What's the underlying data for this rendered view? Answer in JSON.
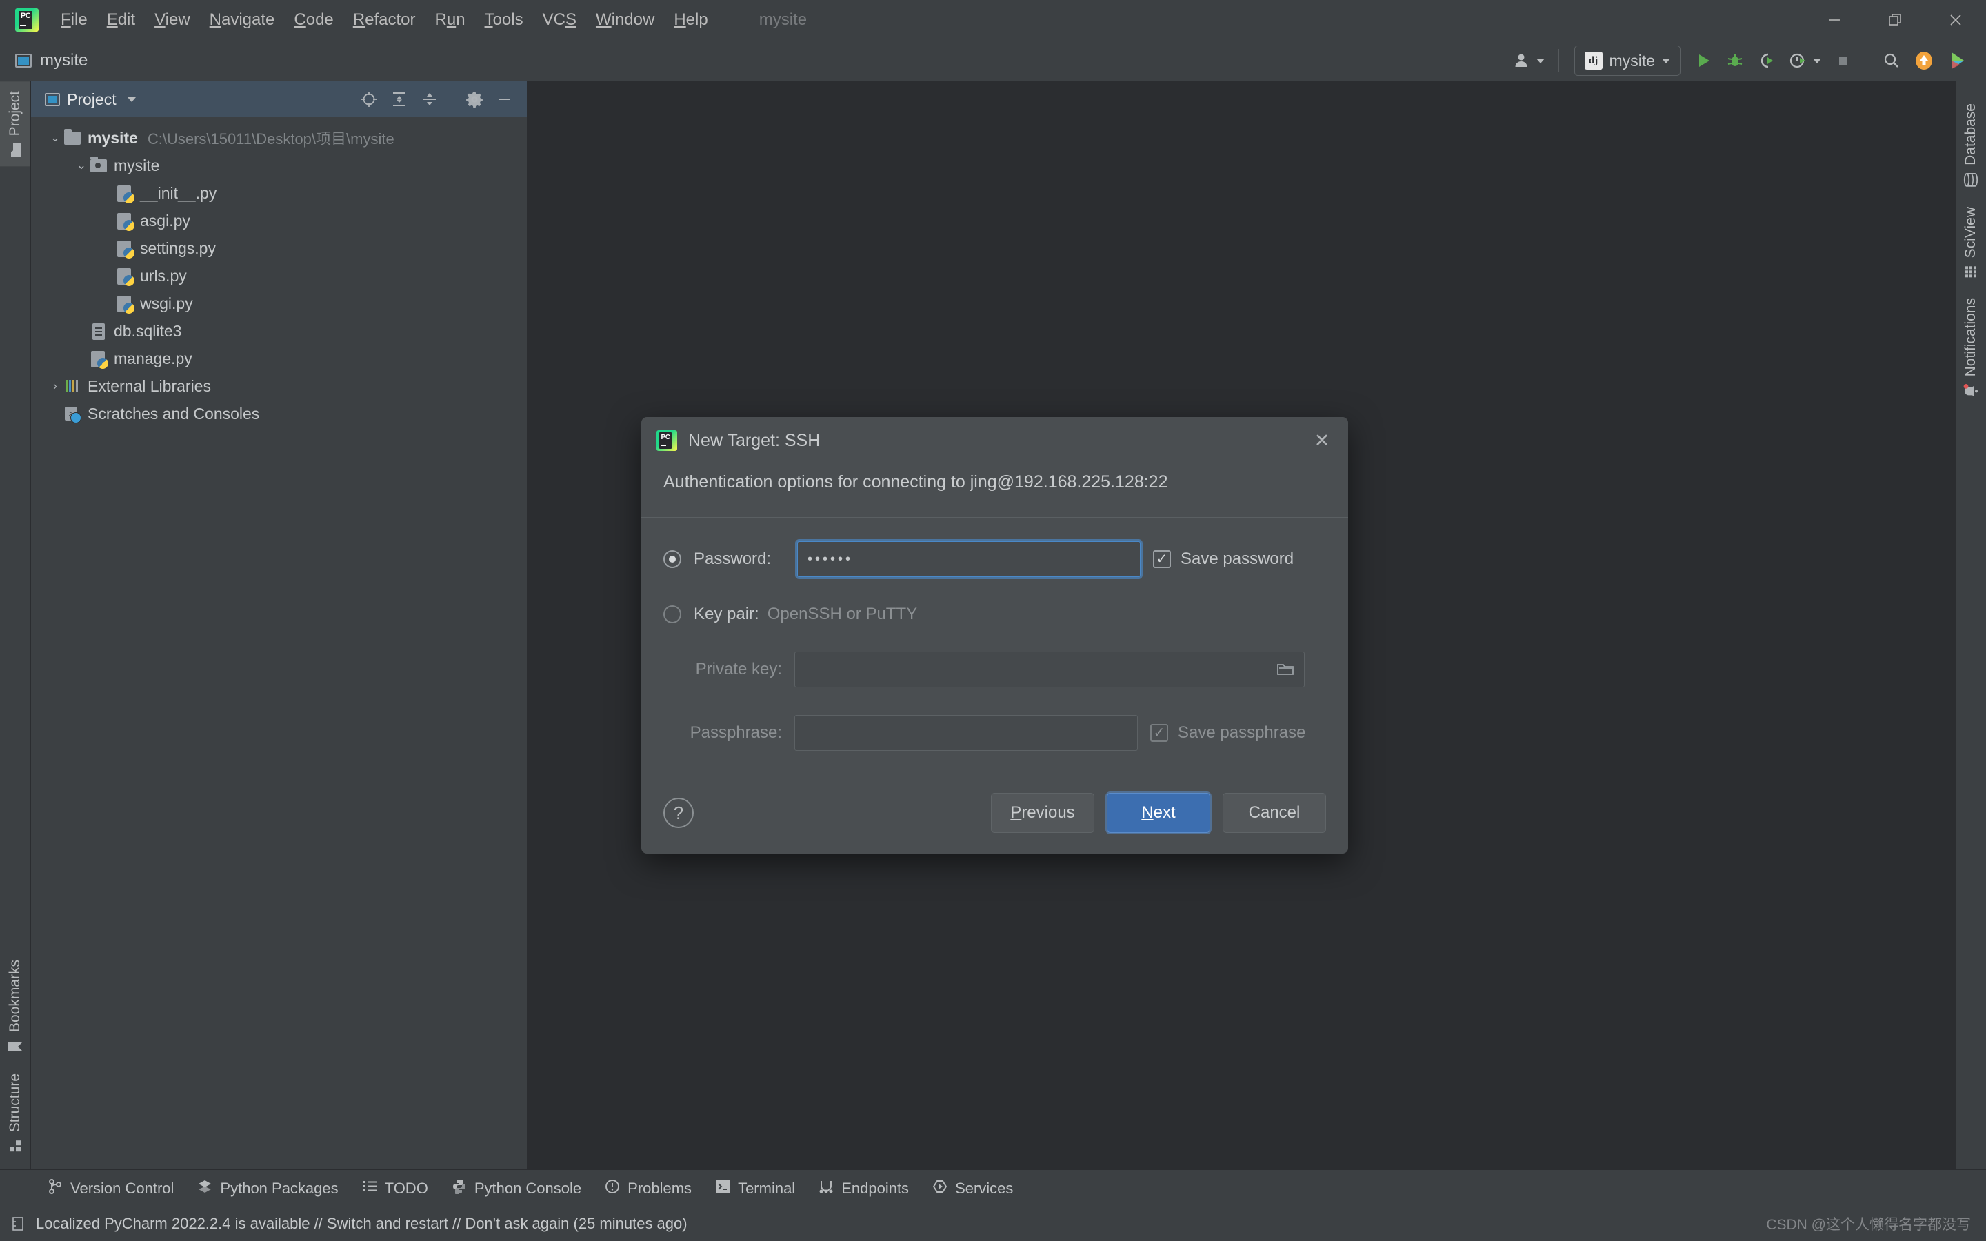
{
  "app": {
    "window_title": "mysite",
    "logo_text": "PC"
  },
  "menu": {
    "items": [
      {
        "label": "File",
        "mnemonic": "F"
      },
      {
        "label": "Edit",
        "mnemonic": "E"
      },
      {
        "label": "View",
        "mnemonic": "V"
      },
      {
        "label": "Navigate",
        "mnemonic": "N"
      },
      {
        "label": "Code",
        "mnemonic": "C"
      },
      {
        "label": "Refactor",
        "mnemonic": "R"
      },
      {
        "label": "Run",
        "mnemonic": "u"
      },
      {
        "label": "Tools",
        "mnemonic": "T"
      },
      {
        "label": "VCS",
        "mnemonic": "S"
      },
      {
        "label": "Window",
        "mnemonic": "W"
      },
      {
        "label": "Help",
        "mnemonic": "H"
      }
    ]
  },
  "window_controls": {
    "minimize": "minimize-icon",
    "restore": "restore-icon",
    "close": "close-icon"
  },
  "toolbar": {
    "breadcrumb": "mysite",
    "run_config": "mysite",
    "run_config_icon": "django-icon",
    "buttons": [
      "user-avatar-icon",
      "run-icon",
      "debug-icon",
      "run-with-coverage-icon",
      "profile-icon",
      "stop-icon",
      "search-everywhere-icon",
      "update-project-icon",
      "ide-features-icon"
    ]
  },
  "left_strip": {
    "top": [
      {
        "label": "Project",
        "icon": "project-folder-icon",
        "selected": true
      }
    ],
    "bottom": [
      {
        "label": "Bookmarks",
        "icon": "bookmark-icon"
      },
      {
        "label": "Structure",
        "icon": "structure-icon"
      }
    ]
  },
  "right_strip": {
    "items": [
      {
        "label": "Database",
        "icon": "database-icon",
        "badge": false
      },
      {
        "label": "SciView",
        "icon": "sciview-grid-icon",
        "badge": false
      },
      {
        "label": "Notifications",
        "icon": "bell-icon",
        "badge": true
      }
    ]
  },
  "project_panel": {
    "title": "Project",
    "tools": [
      "select-opened-file-icon",
      "expand-all-icon",
      "collapse-all-icon",
      "settings-gear-icon",
      "hide-panel-icon"
    ],
    "tree": [
      {
        "depth": 0,
        "arrow": "down",
        "icon": "folder",
        "name": "mysite",
        "bold": true,
        "path": "C:\\Users\\15011\\Desktop\\项目\\mysite"
      },
      {
        "depth": 1,
        "arrow": "down",
        "icon": "package",
        "name": "mysite",
        "bold": false,
        "path": ""
      },
      {
        "depth": 2,
        "arrow": "none",
        "icon": "python",
        "name": "__init__.py",
        "bold": false,
        "path": ""
      },
      {
        "depth": 2,
        "arrow": "none",
        "icon": "python",
        "name": "asgi.py",
        "bold": false,
        "path": ""
      },
      {
        "depth": 2,
        "arrow": "none",
        "icon": "python",
        "name": "settings.py",
        "bold": false,
        "path": ""
      },
      {
        "depth": 2,
        "arrow": "none",
        "icon": "python",
        "name": "urls.py",
        "bold": false,
        "path": ""
      },
      {
        "depth": 2,
        "arrow": "none",
        "icon": "python",
        "name": "wsgi.py",
        "bold": false,
        "path": ""
      },
      {
        "depth": 1,
        "arrow": "none",
        "icon": "db",
        "name": "db.sqlite3",
        "bold": false,
        "path": ""
      },
      {
        "depth": 1,
        "arrow": "none",
        "icon": "python",
        "name": "manage.py",
        "bold": false,
        "path": ""
      },
      {
        "depth": 0,
        "arrow": "right",
        "icon": "library",
        "name": "External Libraries",
        "bold": false,
        "path": ""
      },
      {
        "depth": 0,
        "arrow": "none",
        "icon": "scratch",
        "name": "Scratches and Consoles",
        "bold": false,
        "path": ""
      }
    ]
  },
  "tool_windows": [
    {
      "label": "Version Control",
      "icon": "branch-icon"
    },
    {
      "label": "Python Packages",
      "icon": "packages-icon"
    },
    {
      "label": "TODO",
      "icon": "todo-list-icon"
    },
    {
      "label": "Python Console",
      "icon": "python-icon"
    },
    {
      "label": "Problems",
      "icon": "problems-icon"
    },
    {
      "label": "Terminal",
      "icon": "terminal-icon"
    },
    {
      "label": "Endpoints",
      "icon": "endpoints-icon"
    },
    {
      "label": "Services",
      "icon": "services-icon"
    }
  ],
  "status_bar": {
    "icon": "event-log-icon",
    "message": "Localized PyCharm 2022.2.4 is available // Switch and restart // Don't ask again (25 minutes ago)",
    "watermark": "CSDN @这个人懒得名字都没写"
  },
  "dialog": {
    "title": "New Target: SSH",
    "logo_text": "PC",
    "close_label": "✕",
    "subtitle": "Authentication options for connecting to jing@192.168.225.128:22",
    "password_radio_label": "Password:",
    "password_value": "••••••",
    "password_selected": true,
    "save_password_label": "Save password",
    "save_password_checked": true,
    "keypair_radio_label": "Key pair:",
    "keypair_hint": "OpenSSH or PuTTY",
    "keypair_selected": false,
    "private_key_label": "Private key:",
    "private_key_value": "",
    "private_key_browse_icon": "folder-browse-icon",
    "passphrase_label": "Passphrase:",
    "passphrase_value": "",
    "save_passphrase_label": "Save passphrase",
    "save_passphrase_checked": true,
    "help_label": "?",
    "previous_label": "Previous",
    "previous_mnemonic": "P",
    "next_label": "Next",
    "next_mnemonic": "N",
    "cancel_label": "Cancel",
    "check_glyph": "✓"
  },
  "colors": {
    "accent_blue": "#3c6eb0",
    "focus_blue": "#4a88c7",
    "panel_bg": "#3c4043",
    "editor_bg": "#2b2d30",
    "dialog_bg": "#4a4e51",
    "header_blue": "#41505f",
    "notification_badge": "#e05555",
    "run_green": "#5aab4f"
  }
}
